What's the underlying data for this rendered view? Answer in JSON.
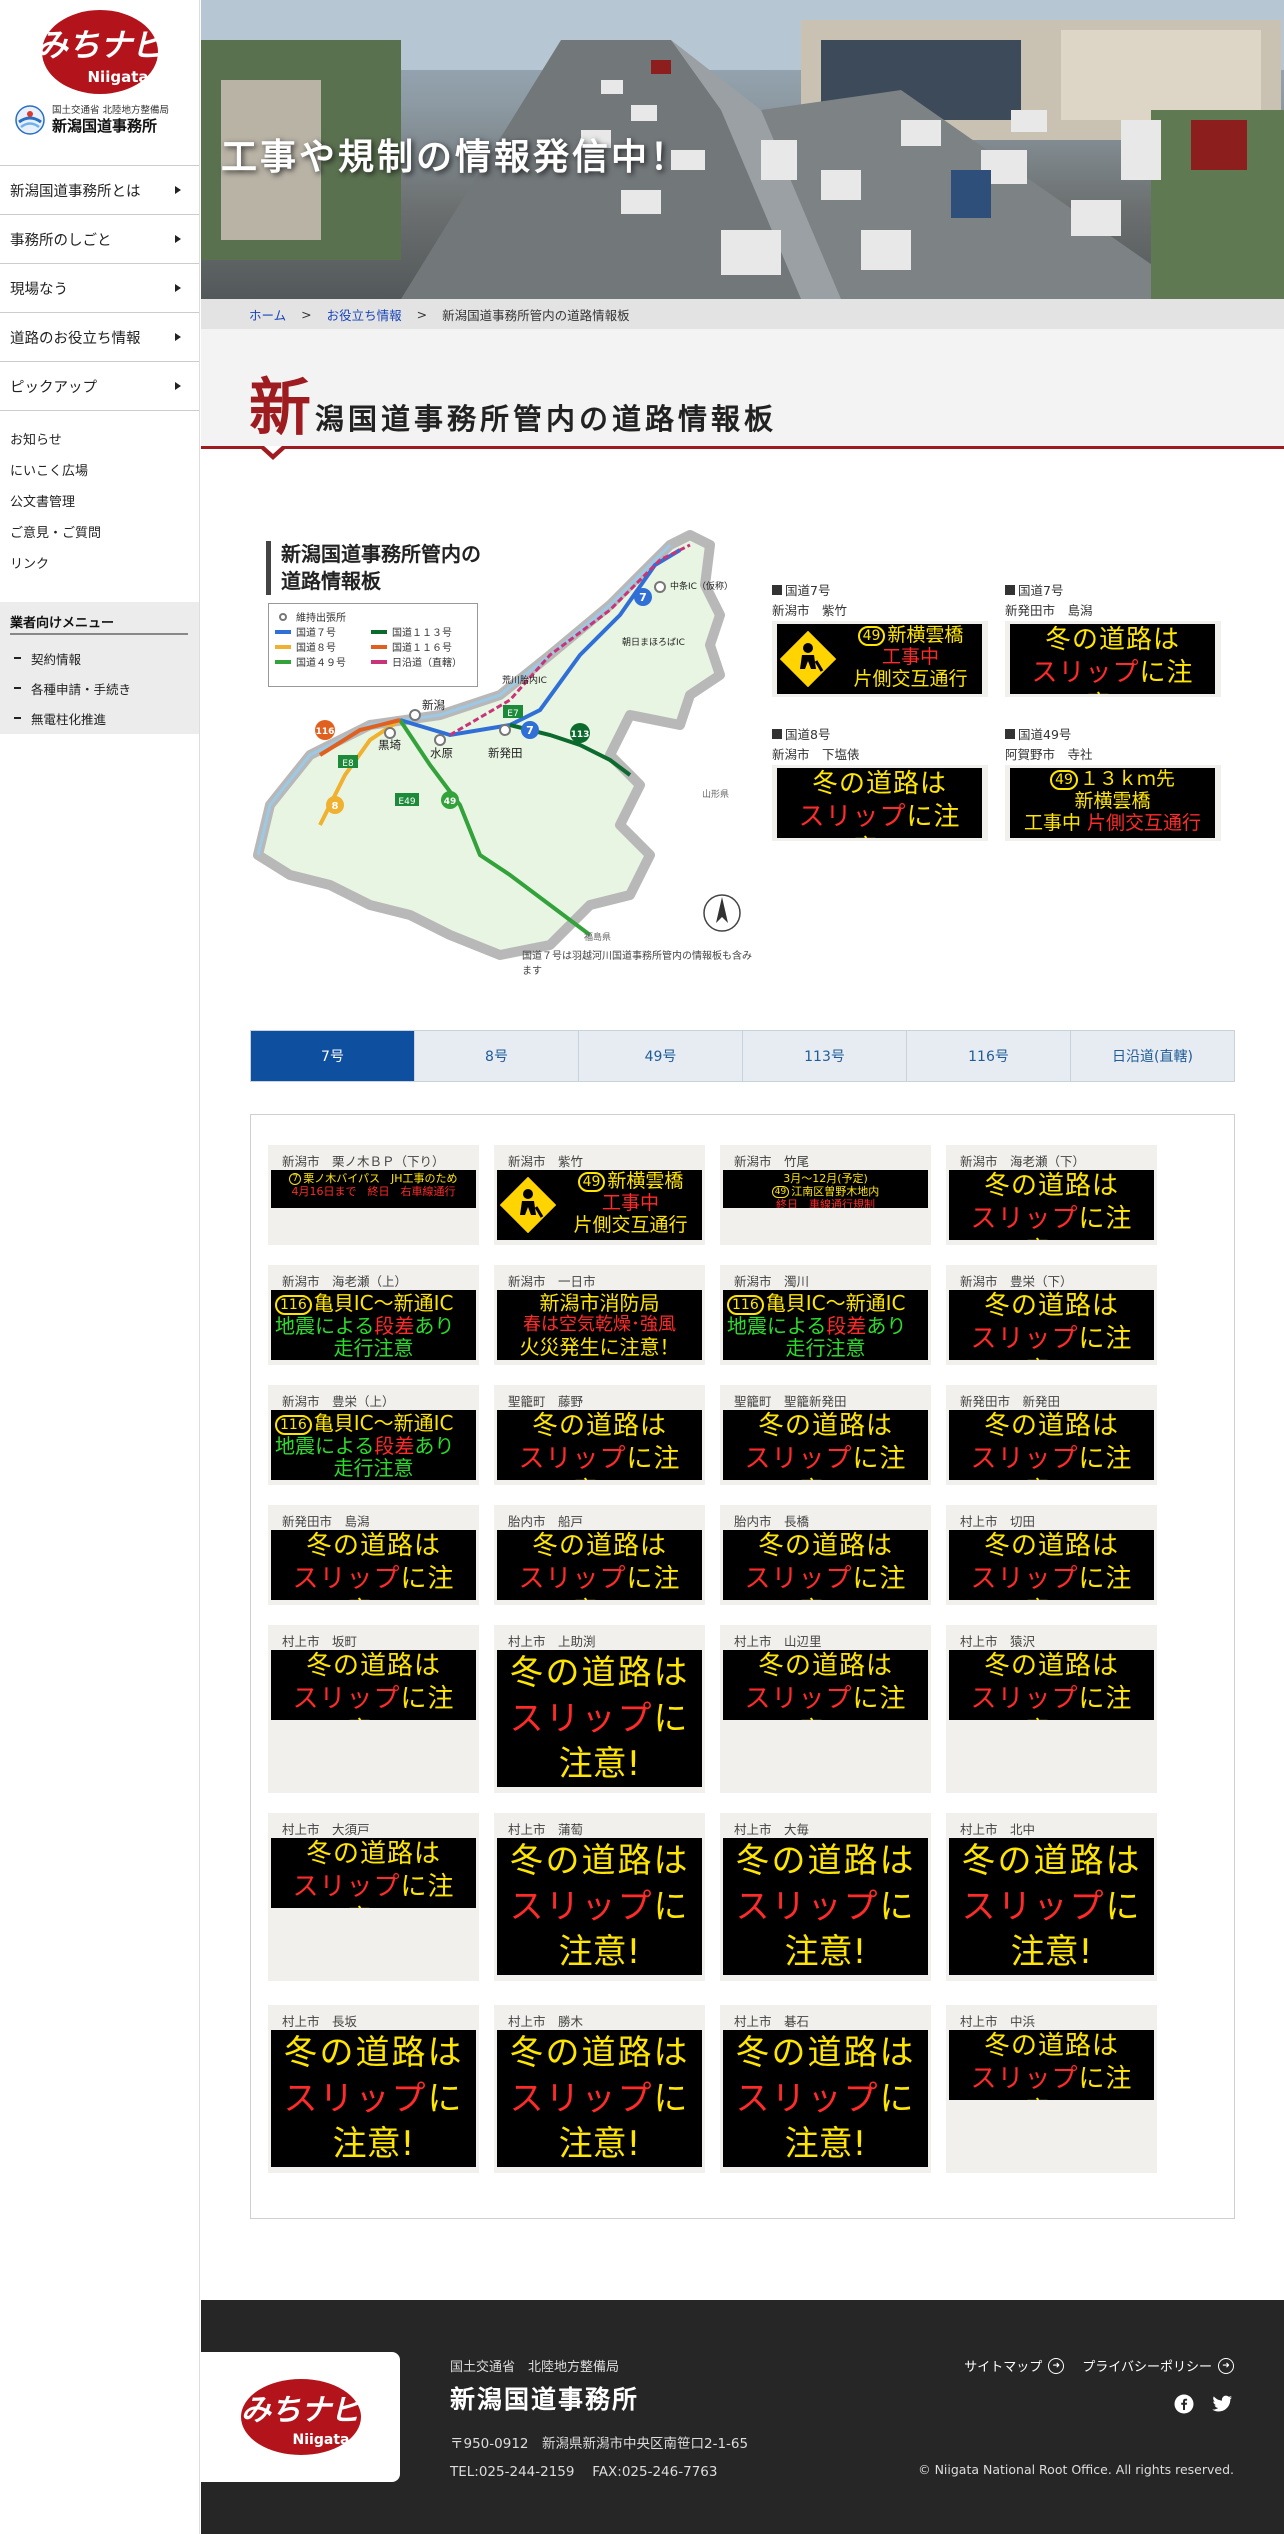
{
  "brand": {
    "logo_text": "みちナビ",
    "logo_sub": "Niigata"
  },
  "org": {
    "ministry": "国土交通省 北陸地方整備局",
    "office": "新潟国道事務所"
  },
  "nav": {
    "main": [
      {
        "label": "新潟国道事務所とは"
      },
      {
        "label": "事務所のしごと"
      },
      {
        "label": "現場なう"
      },
      {
        "label": "道路のお役立ち情報"
      },
      {
        "label": "ピックアップ"
      }
    ],
    "sub": [
      {
        "label": "お知らせ"
      },
      {
        "label": "にいこく広場"
      },
      {
        "label": "公文書管理"
      },
      {
        "label": "ご意見・ご質問"
      },
      {
        "label": "リンク"
      }
    ],
    "business_title": "業者向けメニュー",
    "business": [
      {
        "label": "契約情報"
      },
      {
        "label": "各種申請・手続き"
      },
      {
        "label": "無電柱化推進"
      }
    ]
  },
  "hero": {
    "text": "工事や規制の情報発信中！"
  },
  "breadcrumb": {
    "home": "ホーム",
    "parent": "お役立ち情報",
    "current": "新潟国道事務所管内の道路情報板",
    "sep": ">"
  },
  "page_title": {
    "first_char": "新",
    "rest": "潟国道事務所管内の道路情報板"
  },
  "map": {
    "heading_line1": "新潟国道事務所管内の",
    "heading_line2": "道路情報板",
    "legend": {
      "office": "維持出張所",
      "r7": "国道７号",
      "r8": "国道８号",
      "r49": "国道４９号",
      "r113": "国道１１３号",
      "r116": "国道１１６号",
      "nihonkai": "日沿道（直轄）"
    },
    "places": {
      "niigata": "新潟",
      "kurosaki": "黒埼",
      "suibara": "水原",
      "shibata": "新発田",
      "nakajo": "中条IC（仮称）",
      "asahi": "朝日まほろばIC",
      "arakawa": "荒川胎内IC",
      "yamagata": "山形県",
      "fukushima": "福島県"
    },
    "footnote": "国道７号は羽越河川国道事務所管内の情報板も含みます",
    "colors": {
      "r7": "#2f6fd6",
      "r8": "#f0b030",
      "r49": "#33a23a",
      "r113": "#0d6a2e",
      "r116": "#e0601f",
      "nihonkai": "#c8347a"
    }
  },
  "featured": [
    {
      "route": "国道7号",
      "loc": "新潟市　紫竹"
    },
    {
      "route": "国道7号",
      "loc": "新発田市　島潟"
    },
    {
      "route": "国道8号",
      "loc": "新潟市　下塩俵"
    },
    {
      "route": "国道49号",
      "loc": "阿賀野市　寺社"
    }
  ],
  "messages": {
    "winter_l1": "冬の道路は",
    "winter_l2a": "スリップ",
    "winter_l2b": "に注意！",
    "winter_big_l2a": "スリップ",
    "winter_big_l2b": "に",
    "winter_big_l3": "注意!",
    "const_r": "49",
    "const_l1": "新横雲橋",
    "const_l2": "工事中",
    "const_l3": "片側交互通行",
    "eq_r": "116",
    "eq_l1": "亀貝IC～新通IC",
    "eq_l2a": "地震による",
    "eq_l2b": "段差",
    "eq_l2c": "あり",
    "eq_l3": "走行注意",
    "fire_l1": "新潟市消防局",
    "fire_l2": "春は空気乾燥･強風",
    "fire_l3": "火災発生に注意！",
    "km_r": "49",
    "km_l1": "１３ｋｍ先",
    "km_l2": "新横雲橋",
    "km_l3a": "工事中",
    "km_l3b": "片側交互通行",
    "jh_r": "7",
    "jh_l1": "栗ノ木バイパス　JH工事のため",
    "jh_l2": "4月16日まで　終日　右車線通行",
    "tk_l1": "3月～12月(予定)",
    "tk_r": "49",
    "tk_l2": "江南区曽野木地内",
    "tk_l3": "終日　車線通行規制"
  },
  "tabs": [
    {
      "label": "7号"
    },
    {
      "label": "8号"
    },
    {
      "label": "49号"
    },
    {
      "label": "113号"
    },
    {
      "label": "116号"
    },
    {
      "label": "日沿道(直轄)"
    }
  ],
  "boards": [
    {
      "loc": "新潟市　栗ノ木ＢＰ（下り）"
    },
    {
      "loc": "新潟市　紫竹"
    },
    {
      "loc": "新潟市　竹尾"
    },
    {
      "loc": "新潟市　海老瀬（下）"
    },
    {
      "loc": "新潟市　海老瀬（上）"
    },
    {
      "loc": "新潟市　一日市"
    },
    {
      "loc": "新潟市　濁川"
    },
    {
      "loc": "新潟市　豊栄（下）"
    },
    {
      "loc": "新潟市　豊栄（上）"
    },
    {
      "loc": "聖籠町　藤野"
    },
    {
      "loc": "聖籠町　聖籠新発田"
    },
    {
      "loc": "新発田市　新発田"
    },
    {
      "loc": "新発田市　島潟"
    },
    {
      "loc": "胎内市　船戸"
    },
    {
      "loc": "胎内市　長橋"
    },
    {
      "loc": "村上市　切田"
    },
    {
      "loc": "村上市　坂町"
    },
    {
      "loc": "村上市　上助渕"
    },
    {
      "loc": "村上市　山辺里"
    },
    {
      "loc": "村上市　猿沢"
    },
    {
      "loc": "村上市　大須戸"
    },
    {
      "loc": "村上市　蒲萄"
    },
    {
      "loc": "村上市　大毎"
    },
    {
      "loc": "村上市　北中"
    },
    {
      "loc": "村上市　長坂"
    },
    {
      "loc": "村上市　勝木"
    },
    {
      "loc": "村上市　碁石"
    },
    {
      "loc": "村上市　中浜"
    }
  ],
  "footer": {
    "org": "国土交通省　北陸地方整備局",
    "name": "新潟国道事務所",
    "address": "〒950-0912　新潟県新潟市中央区南笹口2-1-65",
    "tel": "TEL:025-244-2159　 FAX:025-246-7763",
    "sitemap": "サイトマップ",
    "privacy": "プライバシーポリシー",
    "copyright": "© Niigata National Root Office. All rights reserved."
  },
  "colors": {
    "accent": "#9e1b20",
    "tab_active": "#0f4fa0",
    "footer_bg": "#262626"
  }
}
